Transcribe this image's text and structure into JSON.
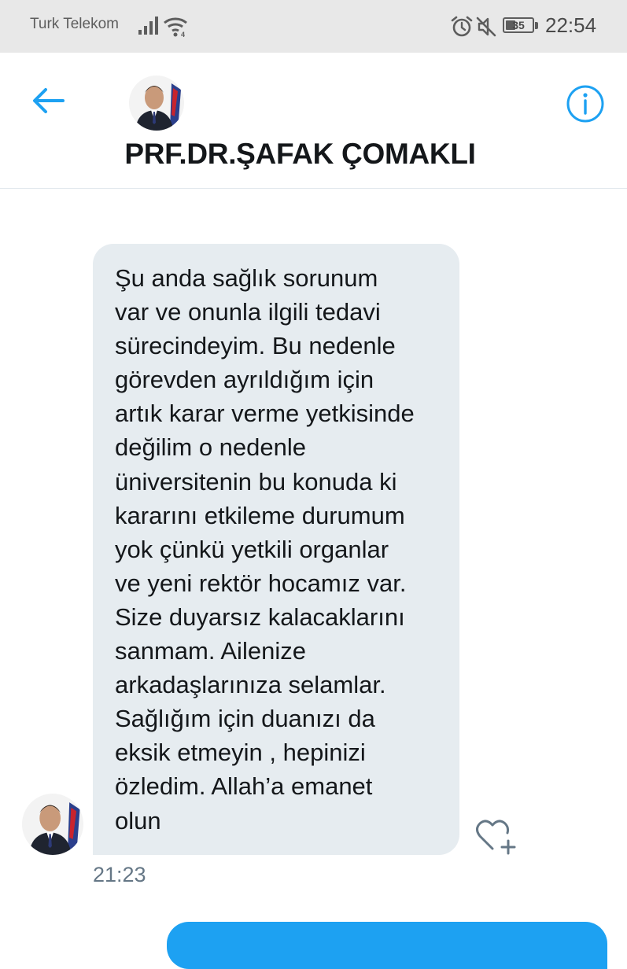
{
  "status_bar": {
    "carrier": "Turk Telekom",
    "battery_level": "35",
    "time": "22:54",
    "icons": [
      "signal-icon",
      "wifi-icon",
      "alarm-icon",
      "mute-icon",
      "battery-icon"
    ]
  },
  "header": {
    "name": "PRF.DR.ŞAFAK ÇOMAKLI",
    "icons": [
      "back-arrow-icon",
      "avatar",
      "info-icon"
    ]
  },
  "message": {
    "text": "Şu anda sağlık sorunum\nvar ve onunla ilgili tedavi\nsürecindeyim. Bu nedenle\ngörevden ayrıldığım için\nartık karar verme yetkisinde\ndeğilim o nedenle\nüniversitenin bu konuda ki\nkararını etkileme durumum\nyok çünkü yetkili organlar\nve yeni rektör hocamız var.\nSize duyarsız kalacaklarını\nsanmam. Ailenize\narkadaşlarınıza selamlar.\nSağlığım için duanızı da\neksik etmeyin , hepinizi\nözledim. Allah’a emanet\nolun",
    "time": "21:23",
    "icons": [
      "avatar",
      "add-reaction-heart-icon"
    ]
  },
  "colors": {
    "accent": "#1da1f2",
    "incoming_bubble": "#e6ecf0",
    "status_bar_bg": "#e8e8e8",
    "timestamp": "#657786",
    "text": "#14171a"
  }
}
